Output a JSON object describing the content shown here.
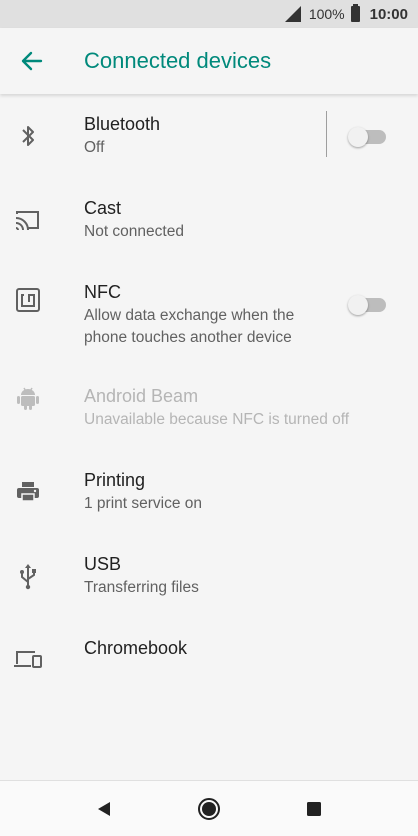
{
  "status_bar": {
    "battery": "100%",
    "time": "10:00"
  },
  "app_bar": {
    "title": "Connected devices"
  },
  "items": [
    {
      "title": "Bluetooth",
      "subtitle": "Off",
      "toggle": "off",
      "icon": "bluetooth-icon"
    },
    {
      "title": "Cast",
      "subtitle": "Not connected",
      "icon": "cast-icon"
    },
    {
      "title": "NFC",
      "subtitle_line1": "Allow data exchange when the",
      "subtitle_line2": "phone touches another device",
      "toggle": "off",
      "icon": "nfc-icon"
    },
    {
      "title": "Android Beam",
      "subtitle": "Unavailable because NFC is turned off",
      "enabled": false,
      "icon": "android-icon"
    },
    {
      "title": "Printing",
      "subtitle": "1 print service on",
      "icon": "printer-icon"
    },
    {
      "title": "USB",
      "subtitle": "Transferring files",
      "icon": "usb-icon"
    },
    {
      "title": "Chromebook",
      "icon": "devices-icon"
    }
  ],
  "colors": {
    "accent": "#00897b",
    "text": "#212121",
    "secondary": "#616161",
    "disabled": "#b5b5b5"
  }
}
